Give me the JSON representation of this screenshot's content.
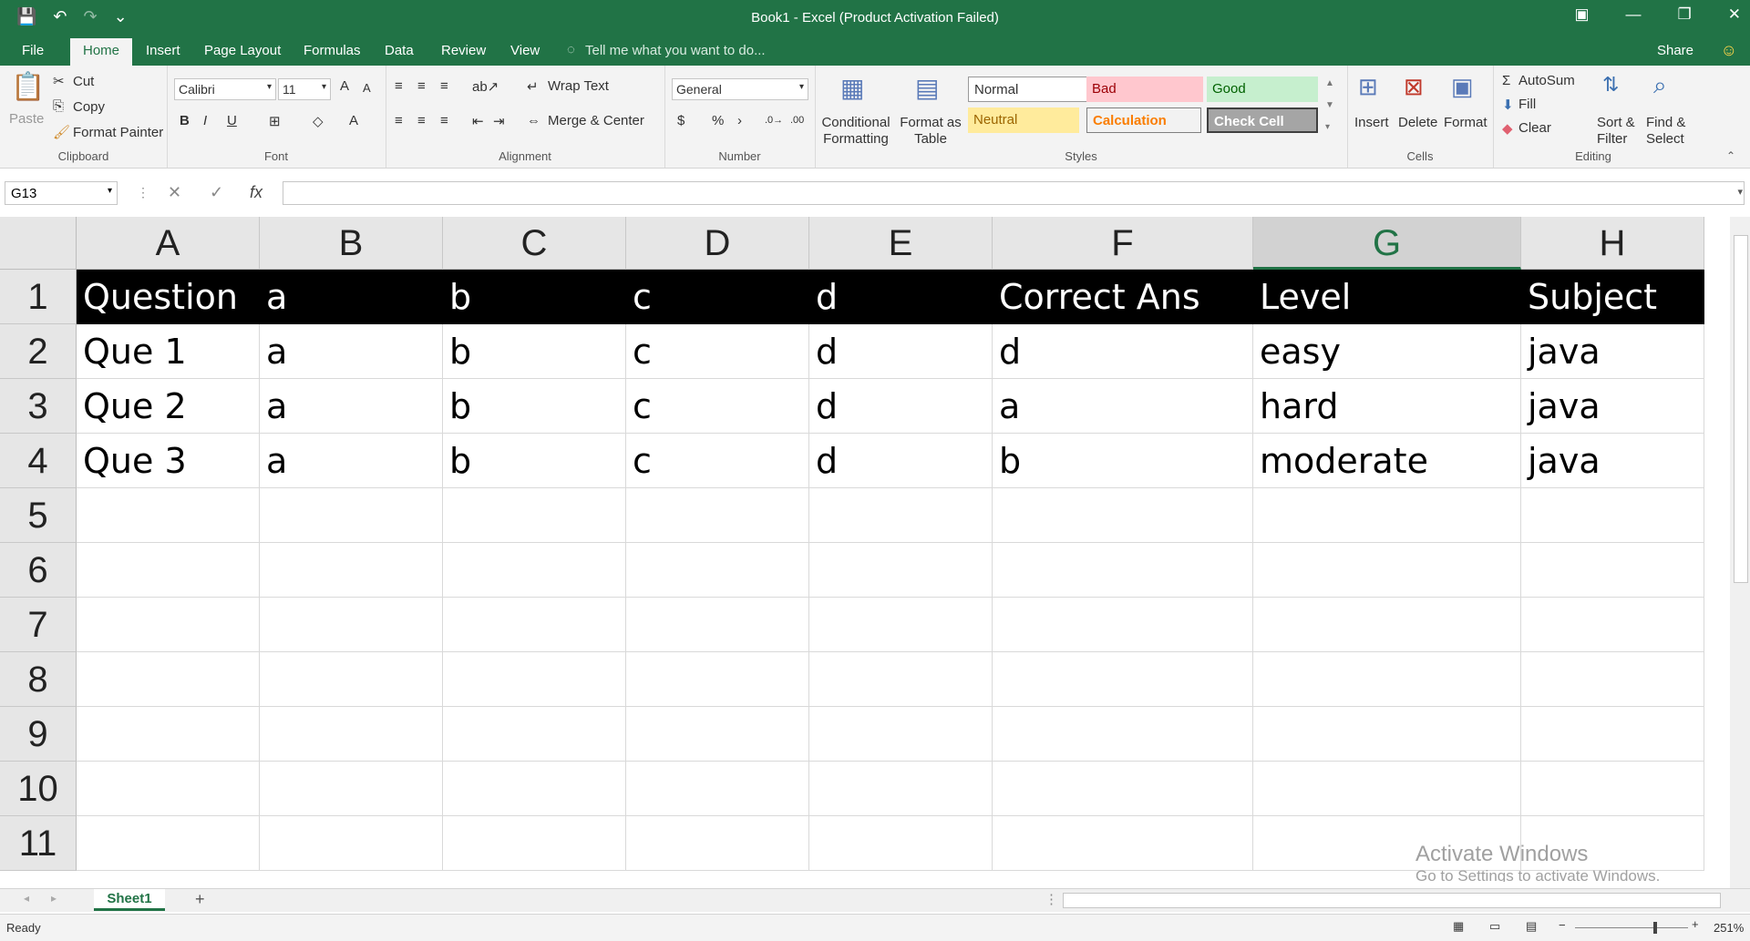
{
  "titlebar": {
    "title": "Book1 - Excel (Product Activation Failed)",
    "save_icon": "💾",
    "undo_icon": "↶",
    "redo_icon": "↷",
    "customize_icon": "⌄",
    "ribbon_display_icon": "▣",
    "minimize_icon": "—",
    "restore_icon": "❐",
    "close_icon": "✕"
  },
  "menu": {
    "file": "File",
    "home": "Home",
    "insert": "Insert",
    "page_layout": "Page Layout",
    "formulas": "Formulas",
    "data": "Data",
    "review": "Review",
    "view": "View",
    "tell_me": "Tell me what you want to do...",
    "share": "Share",
    "smiley_icon": "☺"
  },
  "ribbon": {
    "clipboard": {
      "paste": "Paste",
      "cut": "Cut",
      "copy": "Copy",
      "format_painter": "Format Painter",
      "label": "Clipboard"
    },
    "font": {
      "name": "Calibri",
      "size": "11",
      "grow": "A",
      "shrink": "A",
      "bold": "B",
      "italic": "I",
      "underline": "U",
      "label": "Font"
    },
    "alignment": {
      "wrap": "Wrap Text",
      "merge": "Merge & Center",
      "label": "Alignment"
    },
    "number": {
      "format": "General",
      "currency": "$",
      "percent": "%",
      "comma": "›",
      "label": "Number"
    },
    "styles": {
      "cond_format_1": "Conditional",
      "cond_format_2": "Formatting",
      "format_table_1": "Format as",
      "format_table_2": "Table",
      "normal": "Normal",
      "bad": "Bad",
      "good": "Good",
      "neutral": "Neutral",
      "calculation": "Calculation",
      "check_cell": "Check Cell",
      "label": "Styles"
    },
    "cells": {
      "insert": "Insert",
      "delete": "Delete",
      "format": "Format",
      "label": "Cells"
    },
    "editing": {
      "autosum": "AutoSum",
      "fill": "Fill",
      "clear": "Clear",
      "sort_1": "Sort &",
      "sort_2": "Filter",
      "find_1": "Find &",
      "find_2": "Select",
      "label": "Editing"
    }
  },
  "formula": {
    "name_box": "G13",
    "cancel": "✕",
    "enter": "✓",
    "fx": "fx",
    "value": ""
  },
  "grid": {
    "columns": [
      "A",
      "B",
      "C",
      "D",
      "E",
      "F",
      "G",
      "H"
    ],
    "rows": [
      "1",
      "2",
      "3",
      "4",
      "5",
      "6",
      "7",
      "8",
      "9",
      "10",
      "11"
    ],
    "cells": [
      [
        "Question",
        "a",
        "b",
        "c",
        "d",
        "Correct Ans",
        "Level",
        "Subject"
      ],
      [
        "Que 1",
        "a",
        "b",
        "c",
        "d",
        "d",
        "easy",
        "java"
      ],
      [
        "Que 2",
        "a",
        "b",
        "c",
        "d",
        "a",
        "hard",
        "java"
      ],
      [
        "Que 3",
        "a",
        "b",
        "c",
        "d",
        "b",
        "moderate",
        "java"
      ],
      [
        "",
        "",
        "",
        "",
        "",
        "",
        "",
        ""
      ],
      [
        "",
        "",
        "",
        "",
        "",
        "",
        "",
        ""
      ],
      [
        "",
        "",
        "",
        "",
        "",
        "",
        "",
        ""
      ],
      [
        "",
        "",
        "",
        "",
        "",
        "",
        "",
        ""
      ],
      [
        "",
        "",
        "",
        "",
        "",
        "",
        "",
        ""
      ],
      [
        "",
        "",
        "",
        "",
        "",
        "",
        "",
        ""
      ],
      [
        "",
        "",
        "",
        "",
        "",
        "",
        "",
        ""
      ]
    ]
  },
  "sheet": {
    "tab": "Sheet1",
    "add": "+"
  },
  "status": {
    "ready": "Ready",
    "zoom": "251%"
  },
  "watermark": {
    "line1": "Activate Windows",
    "line2": "Go to Settings to activate Windows."
  }
}
